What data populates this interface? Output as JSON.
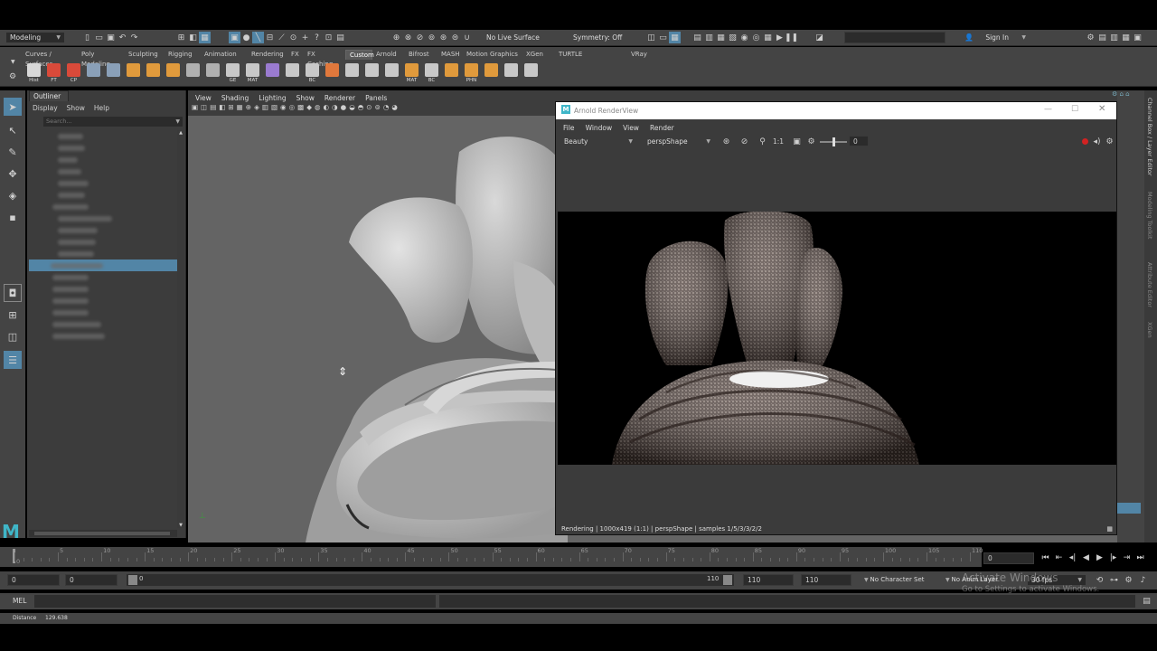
{
  "top_bar": {
    "mode_menu": "Modeling",
    "live_surface": "No Live Surface",
    "symmetry": "Symmetry: Off",
    "sign_in": "Sign In"
  },
  "shelf": {
    "tabs": [
      "Curves / Surfaces",
      "Poly Modeling",
      "Sculpting",
      "Rigging",
      "Animation",
      "Rendering",
      "FX",
      "FX Caching",
      "Custom",
      "Arnold",
      "Bifrost",
      "MASH",
      "Motion Graphics",
      "XGen",
      "TURTLE",
      "",
      "VRay"
    ],
    "active_tab": "Custom",
    "buttons": [
      {
        "label": "Hist",
        "color": "#d8d8d8"
      },
      {
        "label": "FT",
        "color": "#d94a3a"
      },
      {
        "label": "CP",
        "color": "#d94a3a"
      },
      {
        "label": "",
        "color": "#8aa0b8"
      },
      {
        "label": "",
        "color": "#8aa0b8"
      },
      {
        "label": "",
        "color": "#e09a3c"
      },
      {
        "label": "",
        "color": "#e09a3c"
      },
      {
        "label": "",
        "color": "#e09a3c"
      },
      {
        "label": "",
        "color": "#b0b0b0"
      },
      {
        "label": "",
        "color": "#b0b0b0"
      },
      {
        "label": "GE",
        "color": "#c8c8c8"
      },
      {
        "label": "MAT",
        "color": "#c8c8c8"
      },
      {
        "label": "",
        "color": "#9a7bd0"
      },
      {
        "label": "",
        "color": "#c8c8c8"
      },
      {
        "label": "BC",
        "color": "#c8c8c8"
      },
      {
        "label": "",
        "color": "#e0783c"
      },
      {
        "label": "",
        "color": "#c8c8c8"
      },
      {
        "label": "",
        "color": "#c8c8c8"
      },
      {
        "label": "",
        "color": "#c8c8c8"
      },
      {
        "label": "MAT",
        "color": "#e09a3c"
      },
      {
        "label": "BC",
        "color": "#c8c8c8"
      },
      {
        "label": "",
        "color": "#e09a3c"
      },
      {
        "label": "PHN",
        "color": "#e09a3c"
      },
      {
        "label": "",
        "color": "#e09a3c"
      },
      {
        "label": "",
        "color": "#c8c8c8"
      },
      {
        "label": "",
        "color": "#c8c8c8"
      }
    ]
  },
  "outliner": {
    "title": "Outliner",
    "menu": [
      "Display",
      "Show",
      "Help"
    ],
    "search_placeholder": "Search...",
    "items": [
      {
        "indent": 1,
        "w": 28,
        "selected": false
      },
      {
        "indent": 1,
        "w": 30,
        "selected": false
      },
      {
        "indent": 1,
        "w": 22,
        "selected": false
      },
      {
        "indent": 1,
        "w": 26,
        "selected": false
      },
      {
        "indent": 1,
        "w": 34,
        "selected": false
      },
      {
        "indent": 1,
        "w": 30,
        "selected": false
      },
      {
        "indent": 0,
        "w": 40,
        "selected": false
      },
      {
        "indent": 1,
        "w": 60,
        "selected": false
      },
      {
        "indent": 1,
        "w": 44,
        "selected": false
      },
      {
        "indent": 1,
        "w": 42,
        "selected": false
      },
      {
        "indent": 1,
        "w": 40,
        "selected": false
      },
      {
        "indent": 1,
        "w": 58,
        "selected": true
      },
      {
        "indent": 0,
        "w": 40,
        "selected": false
      },
      {
        "indent": 0,
        "w": 40,
        "selected": false
      },
      {
        "indent": 0,
        "w": 40,
        "selected": false
      },
      {
        "indent": 0,
        "w": 40,
        "selected": false
      },
      {
        "indent": 0,
        "w": 54,
        "selected": false
      },
      {
        "indent": 0,
        "w": 58,
        "selected": false
      }
    ]
  },
  "viewport": {
    "menu": [
      "View",
      "Shading",
      "Lighting",
      "Show",
      "Renderer",
      "Panels"
    ]
  },
  "render_view": {
    "title": "Arnold RenderView",
    "menu": [
      "File",
      "Window",
      "View",
      "Render"
    ],
    "aov": "Beauty",
    "camera": "perspShape",
    "ratio": "1:1",
    "exposure": "0",
    "status": "Rendering | 1000x419 (1:1) | perspShape | samples 1/5/3/3/2/2"
  },
  "right_tabs": [
    "Channel Box / Layer Editor",
    "Modeling Toolkit",
    "Attribute Editor",
    "XGen"
  ],
  "timeline": {
    "ticks": [
      0,
      5,
      10,
      15,
      20,
      25,
      30,
      35,
      40,
      45,
      50,
      55,
      60,
      65,
      70,
      75,
      80,
      85,
      90,
      95,
      100,
      105,
      110
    ],
    "current_frame": "0",
    "start_frame": "0",
    "start_field": "0",
    "range_start": "0",
    "range_end": "110",
    "end_field": "110",
    "anim_end": "110",
    "character_set": "No Character Set",
    "anim_layer": "No Anim Layer",
    "fps": "30 fps"
  },
  "command_line": {
    "label": "MEL"
  },
  "help_line": {
    "label": "Distance",
    "value": "129.638"
  },
  "watermark": {
    "line1": "Activate Windows",
    "line2": "Go to Settings to activate Windows."
  },
  "colors": {
    "maya_accent": "#5285a6",
    "selected_row": "#5285a6",
    "record_red": "#d22222",
    "render_title_bar": "#ffffff"
  }
}
